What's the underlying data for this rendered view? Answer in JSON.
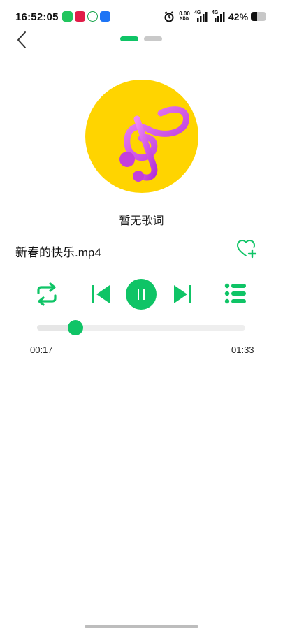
{
  "status_bar": {
    "time": "16:52:05",
    "speed_value": "0.00",
    "speed_unit": "KB/s",
    "network_1": "4G",
    "network_2": "4G",
    "battery_pct": "42%",
    "battery_level": 0.42,
    "notification_icons": [
      "wechat-icon",
      "app-red-icon",
      "app-green-icon",
      "alipay-icon"
    ]
  },
  "header": {
    "back_icon": "chevron-left-icon",
    "page_count": 2,
    "active_page": 1
  },
  "player": {
    "album_icon": "treble-clef-icon",
    "lyrics_placeholder": "暂无歌词",
    "song_title": "新春的快乐.mp4",
    "current_time": "00:17",
    "total_time": "01:33",
    "progress": 0.183,
    "state": "playing"
  },
  "colors": {
    "accent": "#0fc466",
    "album_bg": "#ffd400",
    "clef": "#d640e0"
  }
}
